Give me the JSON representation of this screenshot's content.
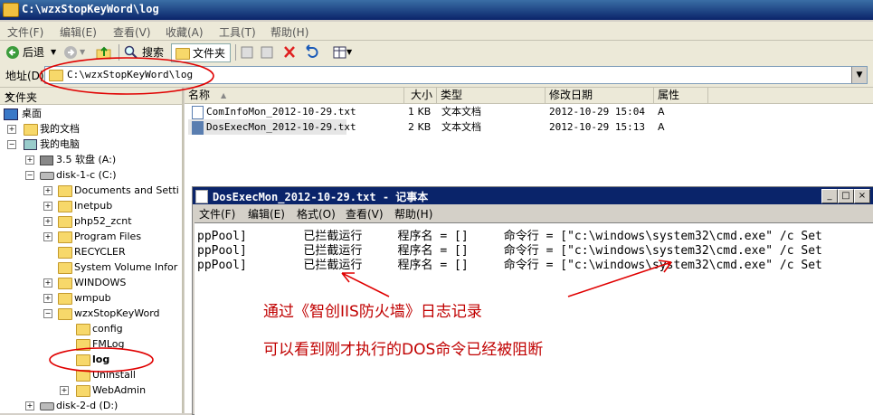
{
  "window": {
    "title": "C:\\wzxStopKeyWord\\log"
  },
  "menu": [
    "文件(F)",
    "编辑(E)",
    "查看(V)",
    "收藏(A)",
    "工具(T)",
    "帮助(H)"
  ],
  "toolbar": {
    "back": "后退",
    "search": "搜索",
    "folders": "文件夹"
  },
  "address": {
    "label": "地址(D)",
    "value": "C:\\wzxStopKeyWord\\log"
  },
  "folder_pane": {
    "title": "文件夹",
    "close": "×",
    "nodes": [
      "桌面",
      "我的文档",
      "我的电脑",
      "3.5 软盘 (A:)",
      "disk-1-c (C:)",
      "Documents and Setti",
      "Inetpub",
      "php52_zcnt",
      "Program Files",
      "RECYCLER",
      "System Volume Infor",
      "WINDOWS",
      "wmpub",
      "wzxStopKeyWord",
      "config",
      "FMLog",
      "log",
      "Uninstall",
      "WebAdmin",
      "disk-2-d (D:)"
    ]
  },
  "file_list": {
    "columns": [
      "名称",
      "大小",
      "类型",
      "修改日期",
      "属性"
    ],
    "rows": [
      {
        "name": "ComInfoMon_2012-10-29.txt",
        "size": "1 KB",
        "type": "文本文档",
        "date": "2012-10-29 15:04",
        "attr": "A"
      },
      {
        "name": "DosExecMon_2012-10-29.txt",
        "size": "2 KB",
        "type": "文本文档",
        "date": "2012-10-29 15:13",
        "attr": "A"
      }
    ]
  },
  "notepad": {
    "title": "DosExecMon_2012-10-29.txt - 记事本",
    "menu": [
      "文件(F)",
      "编辑(E)",
      "格式(O)",
      "查看(V)",
      "帮助(H)"
    ],
    "lines": [
      "ppPool]        已拦截运行     程序名 = []     命令行 = [\"c:\\windows\\system32\\cmd.exe\" /c Set",
      "ppPool]        已拦截运行     程序名 = []     命令行 = [\"c:\\windows\\system32\\cmd.exe\" /c Set",
      "ppPool]        已拦截运行     程序名 = []     命令行 = [\"c:\\windows\\system32\\cmd.exe\" /c Set"
    ]
  },
  "annotations": {
    "line1": "通过《智创IIS防火墙》日志记录",
    "line2": "可以看到刚才执行的DOS命令已经被阻断",
    "color": "#c00000"
  }
}
